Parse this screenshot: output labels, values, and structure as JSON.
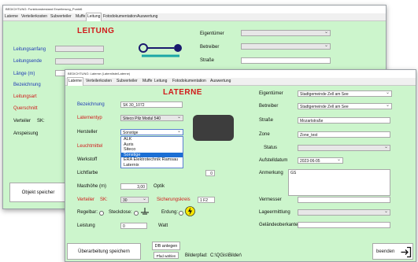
{
  "back_window": {
    "title": "BEDICHTUNG: Funktionsbestand Erweiterung_Punkt6",
    "tabs": [
      "Laterne",
      "Verteilerkosten",
      "Subverteiler",
      "Muffe",
      "Leitung",
      "Fotodokumentation",
      "Auswertung"
    ],
    "active_tab": 4,
    "heading": "LEITUNG",
    "labels": {
      "leitungsanfang": "Leitungsanfang",
      "leitungsende": "Leitungsende",
      "laenge": "Länge (m)",
      "bezeichnung": "Bezeichnung",
      "leitungsart": "Leitungsart",
      "querschnitt": "Querschnitt",
      "verteiler": "Verteiler",
      "sk": "SK:",
      "anspeisung": "Anspeisung",
      "eigentuemer": "Eigentümer",
      "betreiber": "Betreiber",
      "strasse": "Straße"
    },
    "save_button": "Objekt speicher"
  },
  "front_window": {
    "title": "BEDICHTUNG: Laterne (Laternliste/Laterne)",
    "tabs": [
      "Laterne",
      "Verteilerkosten",
      "Subverteiler",
      "Muffe",
      "Leitung",
      "Fotodokumentation",
      "Auswertung"
    ],
    "active_tab": 0,
    "heading": "LATERNE",
    "fields": {
      "bezeichnung": {
        "label": "Bezeichnung",
        "value": "SK 30_1072"
      },
      "laternentyp": {
        "label": "Laternentyp",
        "value": "Siteco Pilz Modul 540"
      },
      "hersteller": {
        "label": "Hersteller",
        "value": "Sonstige"
      },
      "leuchtmittel": {
        "label": "Leuchtmittel"
      },
      "werkstoff": {
        "label": "Werkstoff"
      },
      "lichtfarbe": {
        "label": "Lichtfarbe",
        "value": "0"
      },
      "masthoehe": {
        "label": "Masthöhe (m)",
        "value": "3,00"
      },
      "optik": {
        "label": "Optik"
      },
      "verteiler": {
        "label": "Verteiler",
        "value": "SK:"
      },
      "verteiler_sk": {
        "value": "30"
      },
      "sicherungskreis": {
        "label": "Sicherungskreis",
        "value": "1 F2"
      },
      "regelbar": {
        "label": "Regelbar:"
      },
      "steckdose": {
        "label": "Steckdose:"
      },
      "erdung": {
        "label": "Erdung:"
      },
      "leistung": {
        "label": "Leistung",
        "value": "0",
        "unit": "Watt"
      },
      "eigentuemer": {
        "label": "Eigentümer",
        "value": "Stadtgemeinde Zell am See"
      },
      "betreiber": {
        "label": "Betreiber",
        "value": "Stadtgemeinde Zell am See"
      },
      "strasse": {
        "label": "Straße",
        "value": "Mozartstraße"
      },
      "zone": {
        "label": "Zone",
        "value": "Zone_test"
      },
      "status": {
        "label": "Status"
      },
      "aufstelldatum": {
        "label": "Aufstelldatum",
        "value": "2023-06-05"
      },
      "anmerkung": {
        "label": "Anmerkung",
        "value": "GS"
      },
      "vermesser": {
        "label": "Vermesser"
      },
      "lageermittlung": {
        "label": "Lageermittlung"
      },
      "gelaendeoberkante": {
        "label": "Geländeoberkante"
      }
    },
    "dropdown_options": [
      "ALK",
      "Auris",
      "Siteco",
      "Sonstige",
      "ERA Elektrotechnik Ramsau",
      "Laternix"
    ],
    "dropdown_selected": 3,
    "buttons": {
      "save": "Überarbeitung speichern",
      "db_anlegen": "DB anlegen",
      "pfad_waehlen": "Pfad wählen",
      "beenden": "beenden"
    },
    "bilderpfad": {
      "label": "Bilderpfad:",
      "value": "C:\\QGis\\Bilder\\"
    }
  },
  "colors": {
    "form_bg": "#ccf5cc",
    "label_blue": "#1f3bb5",
    "label_red": "#d11a1a",
    "dropdown_highlight": "#1c6fd4"
  }
}
